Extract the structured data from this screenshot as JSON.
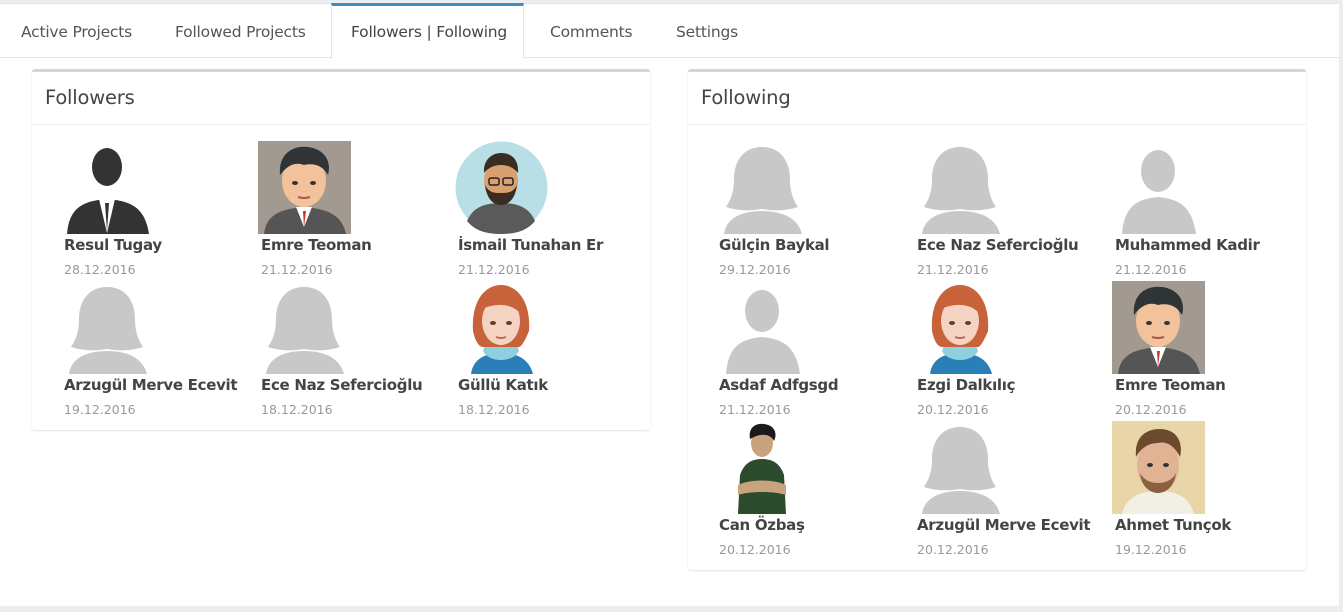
{
  "tabs": [
    {
      "label": "Active Projects",
      "active": false
    },
    {
      "label": "Followed Projects",
      "active": false
    },
    {
      "label": "Followers | Following",
      "active": true
    },
    {
      "label": "Comments",
      "active": false
    },
    {
      "label": "Settings",
      "active": false
    }
  ],
  "followers": {
    "title": "Followers",
    "people": [
      {
        "name": "Resul Tugay",
        "date": "28.12.2016",
        "avatar": "businessman-silhouette-icon"
      },
      {
        "name": "Emre Teoman",
        "date": "21.12.2016",
        "avatar": "cartoon-man-suit-icon"
      },
      {
        "name": "İsmail Tunahan Er",
        "date": "21.12.2016",
        "avatar": "bearded-man-round-icon"
      },
      {
        "name": "Arzugül Merve Ecevit",
        "date": "19.12.2016",
        "avatar": "female-placeholder-icon"
      },
      {
        "name": "Ece Naz Sefercioğlu",
        "date": "18.12.2016",
        "avatar": "female-placeholder-icon"
      },
      {
        "name": "Güllü Katık",
        "date": "18.12.2016",
        "avatar": "cartoon-woman-redhead-icon"
      }
    ]
  },
  "following": {
    "title": "Following",
    "people": [
      {
        "name": "Gülçin Baykal",
        "date": "29.12.2016",
        "avatar": "female-placeholder-icon"
      },
      {
        "name": "Ece Naz Sefercioğlu",
        "date": "21.12.2016",
        "avatar": "female-placeholder-icon"
      },
      {
        "name": "Muhammed Kadir",
        "date": "21.12.2016",
        "avatar": "male-placeholder-icon"
      },
      {
        "name": "Asdaf Adfgsgd",
        "date": "21.12.2016",
        "avatar": "male-placeholder-icon"
      },
      {
        "name": "Ezgi Dalkılıç",
        "date": "20.12.2016",
        "avatar": "cartoon-woman-redhead-icon"
      },
      {
        "name": "Emre Teoman",
        "date": "20.12.2016",
        "avatar": "cartoon-man-suit-icon"
      },
      {
        "name": "Can Özbaş",
        "date": "20.12.2016",
        "avatar": "photo-man-crossed-arms-icon"
      },
      {
        "name": "Arzugül Merve Ecevit",
        "date": "20.12.2016",
        "avatar": "female-placeholder-icon"
      },
      {
        "name": "Ahmet Tunçok",
        "date": "19.12.2016",
        "avatar": "photo-man-portrait-icon"
      }
    ]
  }
}
